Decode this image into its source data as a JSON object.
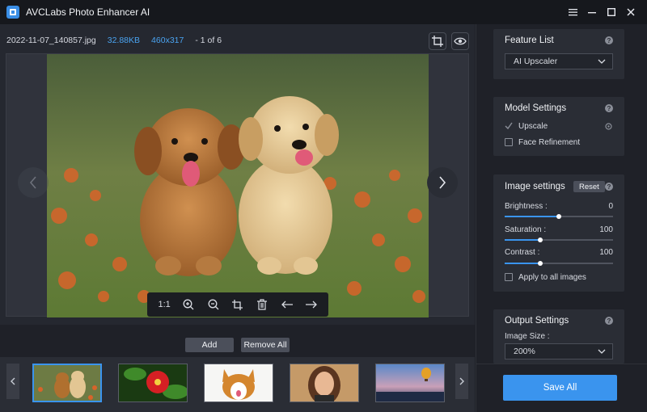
{
  "app": {
    "title": "AVCLabs Photo Enhancer AI"
  },
  "file_info": {
    "name": "2022-11-07_140857.jpg",
    "size": "32.88KB",
    "dimensions": "460x317",
    "page": "- 1 of 6"
  },
  "image_toolbar": {
    "actual_size_label": "1:1"
  },
  "bottom": {
    "add_label": "Add",
    "remove_all_label": "Remove All"
  },
  "thumbnails": [
    "puppies",
    "red-flower",
    "corgi",
    "woman-portrait",
    "hot-air-balloon"
  ],
  "feature_list": {
    "title": "Feature List",
    "selected": "AI Upscaler"
  },
  "model_settings": {
    "title": "Model Settings",
    "upscale_label": "Upscale",
    "upscale_checked": true,
    "face_refinement_label": "Face Refinement",
    "face_refinement_checked": false
  },
  "image_settings": {
    "title": "Image settings",
    "reset_label": "Reset",
    "brightness_label": "Brightness :",
    "brightness_value": "0",
    "brightness_level": 0.5,
    "saturation_label": "Saturation :",
    "saturation_value": "100",
    "saturation_level": 0.33,
    "contrast_label": "Contrast :",
    "contrast_value": "100",
    "contrast_level": 0.33,
    "apply_all_label": "Apply to all images"
  },
  "output_settings": {
    "title": "Output Settings",
    "image_size_label": "Image Size :",
    "image_size_value": "200%"
  },
  "save_all_label": "Save All",
  "colors": {
    "accent": "#3a94ee",
    "info_blue": "#4aa3f0",
    "background": "#1f2128",
    "panel": "#2a2d35"
  }
}
